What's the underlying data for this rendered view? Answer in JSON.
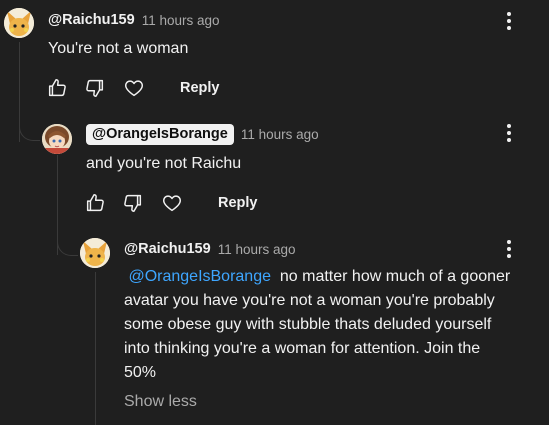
{
  "comments": [
    {
      "author": "@Raichu159",
      "time": "11 hours ago",
      "text": "You're not a woman",
      "reply_label": "Reply"
    },
    {
      "author": "@OrangeIsBorange",
      "time": "11 hours ago",
      "text": "and you're not Raichu",
      "reply_label": "Reply"
    },
    {
      "author": "@Raichu159",
      "time": "11 hours ago",
      "mention": "@OrangeIsBorange",
      "text_line1": "no matter how much of a gooner",
      "text_line2": "avatar you have you're not a woman you're probably",
      "text_line3": "some obese guy with stubble thats deluded yourself",
      "text_line4": "into thinking you're a woman for attention. Join the",
      "text_line5": "50%",
      "show_less_label": "Show less"
    }
  ],
  "icons": {
    "like": "thumbs-up-icon",
    "dislike": "thumbs-down-icon",
    "heart": "heart-icon",
    "more": "more-vert-icon",
    "avatar1": "raichu-avatar",
    "avatar2": "anime-girl-avatar"
  },
  "colors": {
    "background": "#1f1f1f",
    "text": "#f1f1f1",
    "secondary": "#aaaaaa",
    "mention": "#3ea6ff"
  }
}
